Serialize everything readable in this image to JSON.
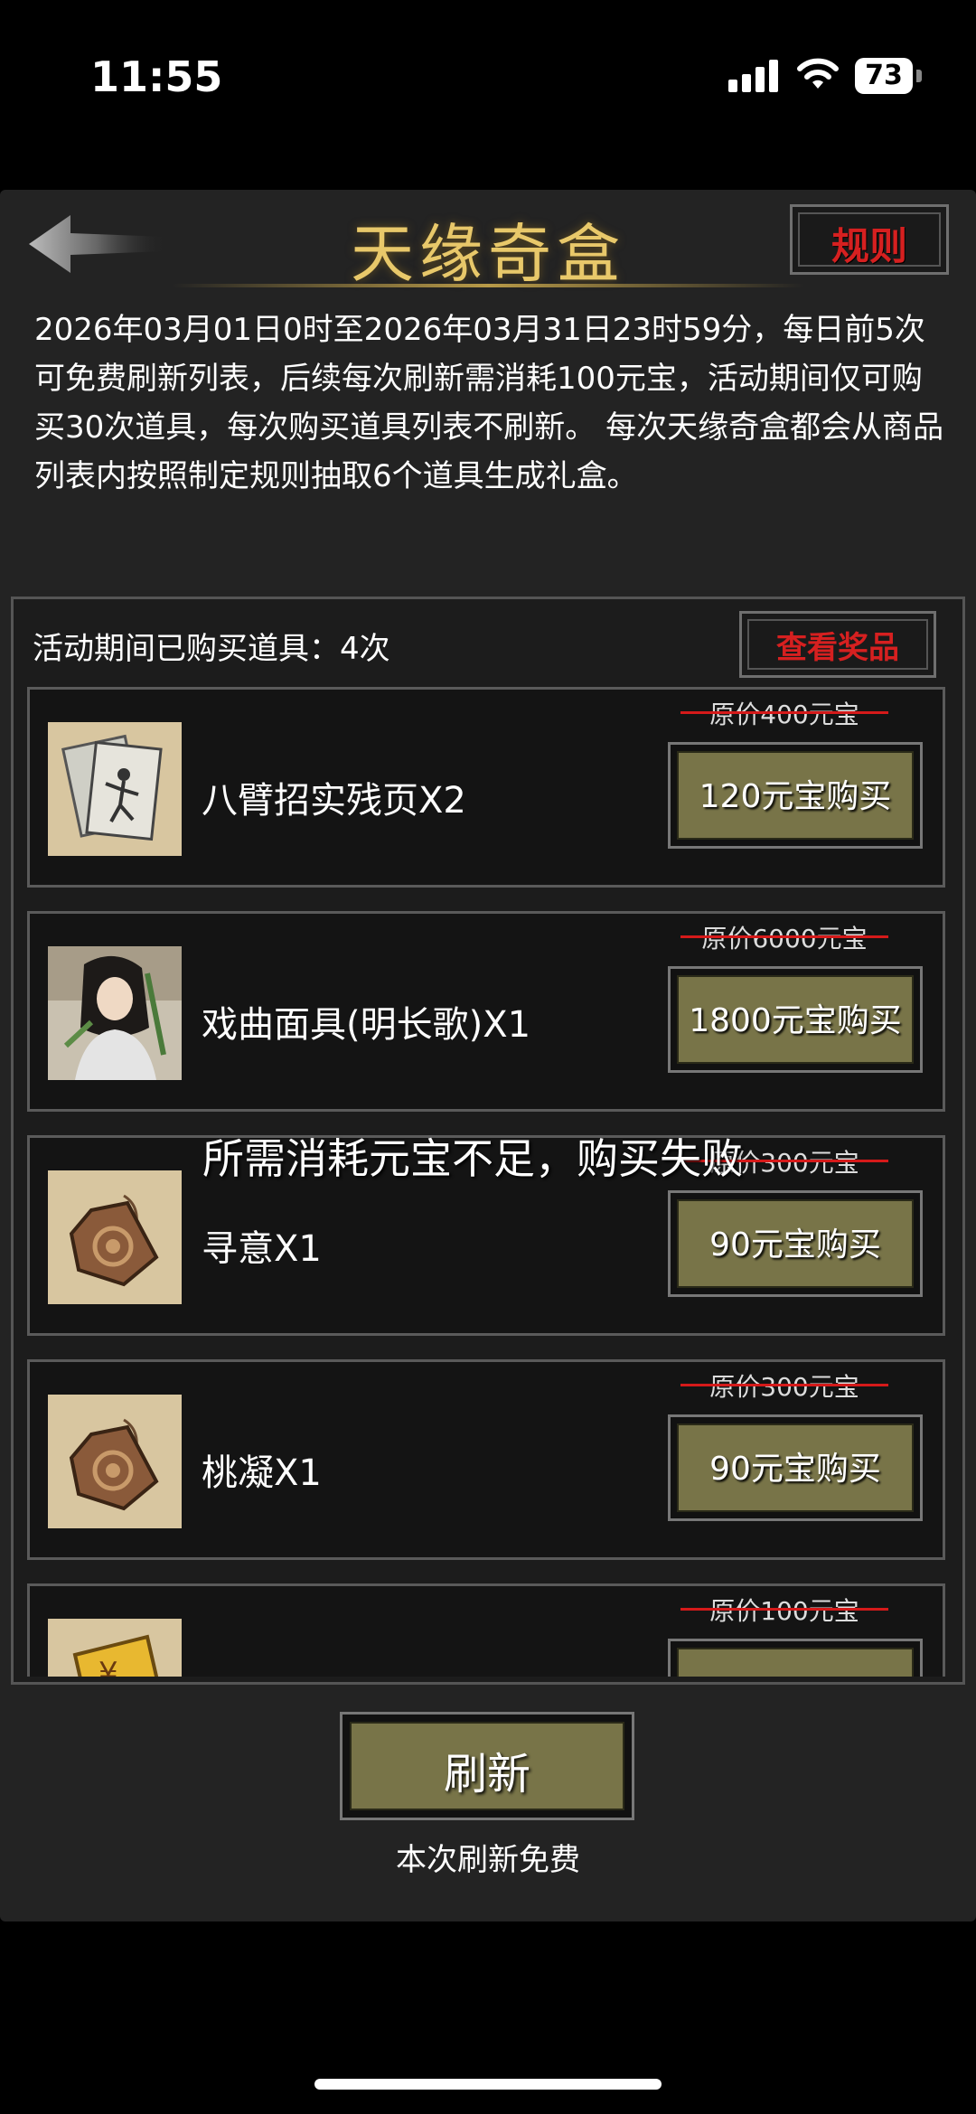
{
  "status_bar": {
    "time": "11:55",
    "battery": "73"
  },
  "header": {
    "title": "天缘奇盒",
    "rules_label": "规则"
  },
  "description": "2026年03月01日0时至2026年03月31日23时59分，每日前5次可免费刷新列表，后续每次刷新需消耗100元宝，活动期间仅可购买30次道具，每次购买道具列表不刷新。 每次天缘奇盒都会从商品列表内按照制定规则抽取6个道具生成礼盒。",
  "summary": {
    "purchased_text": "活动期间已购买道具：4次",
    "view_prizes_label": "查看奖品"
  },
  "items": [
    {
      "name": "八臂招实残页X2",
      "original_price": "原价400元宝",
      "buy_label": "120元宝购买",
      "icon": "scroll-pages-icon"
    },
    {
      "name": "戏曲面具(明长歌)X1",
      "original_price": "原价6000元宝",
      "buy_label": "1800元宝购买",
      "icon": "character-portrait-icon"
    },
    {
      "name": "寻意X1",
      "original_price": "原价300元宝",
      "buy_label": "90元宝购买",
      "icon": "token-pendant-icon"
    },
    {
      "name": "桃凝X1",
      "original_price": "原价300元宝",
      "buy_label": "90元宝购买",
      "icon": "token-pendant-icon"
    },
    {
      "name": "",
      "original_price": "原价100元宝",
      "buy_label": "",
      "icon": "gold-ticket-icon"
    }
  ],
  "toast": "所需消耗元宝不足，购买失败",
  "footer": {
    "refresh_label": "刷新",
    "refresh_note": "本次刷新免费"
  },
  "colors": {
    "accent_gold": "#e8c86a",
    "button_olive": "#787448",
    "alert_red": "#d62020"
  }
}
